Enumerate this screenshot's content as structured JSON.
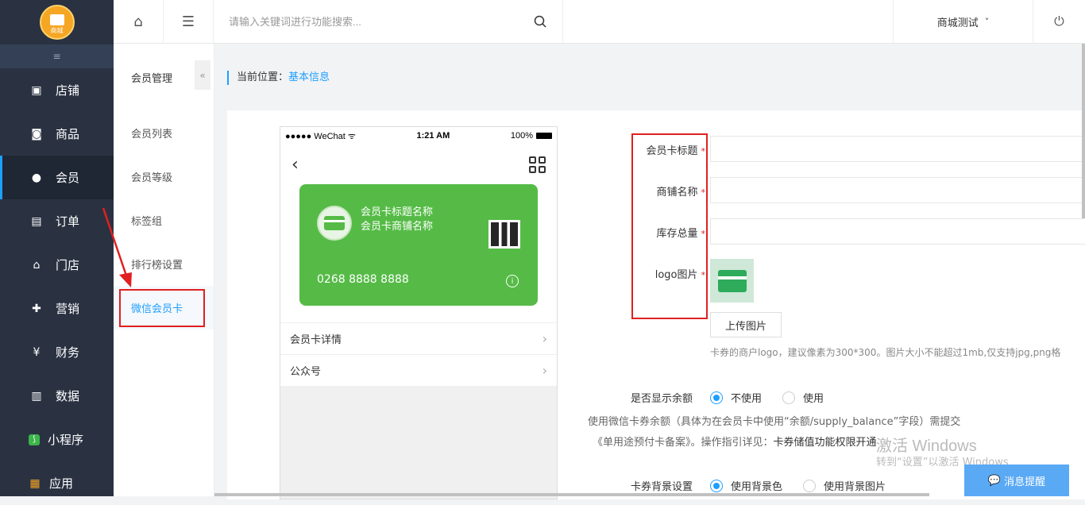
{
  "sidebar": {
    "logo_text": "商城",
    "collapse_icon": "≡",
    "items": [
      {
        "label": "店铺",
        "icon": "shop-icon"
      },
      {
        "label": "商品",
        "icon": "bag-icon"
      },
      {
        "label": "会员",
        "icon": "user-icon"
      },
      {
        "label": "订单",
        "icon": "order-icon"
      },
      {
        "label": "门店",
        "icon": "store-icon"
      },
      {
        "label": "营销",
        "icon": "gift-icon"
      },
      {
        "label": "财务",
        "icon": "money-icon"
      },
      {
        "label": "数据",
        "icon": "chart-icon"
      },
      {
        "label": "小程序",
        "icon": "miniapp-icon"
      },
      {
        "label": "应用",
        "icon": "apps-icon"
      }
    ],
    "active": "会员"
  },
  "topbar": {
    "search_placeholder": "请输入关键词进行功能搜索...",
    "shop_name": "商城测试",
    "shop_caret": "˅"
  },
  "subnav": {
    "title": "会员管理",
    "collapse": "«",
    "items": [
      "会员列表",
      "会员等级",
      "标签组",
      "排行榜设置",
      "微信会员卡"
    ],
    "active": "微信会员卡"
  },
  "breadcrumb": {
    "prefix": "当前位置：",
    "current": "基本信息"
  },
  "phone": {
    "carrier": "●●●●● WeChat ᯤ",
    "time": "1:21 AM",
    "battery": "100%",
    "back": "‹",
    "card": {
      "title": "会员卡标题名称",
      "shop": "会员卡商铺名称",
      "number": "0268 8888 8888",
      "info": "i",
      "color": "#55bb46"
    },
    "rows": [
      {
        "label": "会员卡详情",
        "arrow": "›"
      },
      {
        "label": "公众号",
        "arrow": "›"
      }
    ]
  },
  "form": {
    "fields": [
      {
        "label": "会员卡标题",
        "required": "*"
      },
      {
        "label": "商铺名称",
        "required": "*"
      },
      {
        "label": "库存总量",
        "required": "*"
      },
      {
        "label": "logo图片",
        "required": "*"
      }
    ],
    "upload_label": "上传图片",
    "logo_hint": "卡券的商户logo，建议像素为300*300。图片大小不能超过1mb,仅支持jpg,png格",
    "balance": {
      "label": "是否显示余额",
      "options": [
        "不使用",
        "使用"
      ],
      "selected": "不使用"
    },
    "balance_note_1": "使用微信卡券余额（具体为在会员卡中使用“余额/supply_balance”字段）需提交",
    "balance_note_2": "《单用途预付卡备案》。操作指引详见：",
    "balance_note_link": "卡券储值功能权限开通",
    "bg": {
      "label": "卡券背景设置",
      "options": [
        "使用背景色",
        "使用背景图片"
      ],
      "selected": "使用背景色"
    }
  },
  "watermark": {
    "line1": "激活 Windows",
    "line2": "转到“设置”以激活 Windows"
  },
  "message_button": "消息提醒",
  "colors": {
    "accent": "#1e9fff",
    "sidebar_bg": "#2a3242",
    "annotation_red": "#e02020"
  }
}
